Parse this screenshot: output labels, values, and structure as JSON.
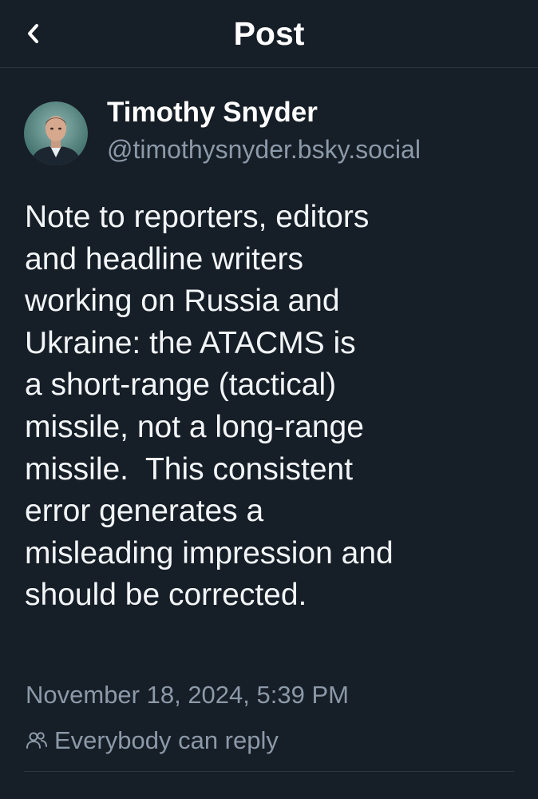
{
  "header": {
    "title": "Post",
    "back_icon": "chevron-left-icon"
  },
  "author": {
    "name": "Timothy Snyder",
    "handle": "@timothysnyder.bsky.social",
    "avatar_icon": "user-avatar-photo"
  },
  "post": {
    "lines": [
      "Note to reporters, editors",
      "and headline writers",
      "working on Russia and",
      "Ukraine: the ATACMS is",
      "a short-range (tactical)",
      "missile, not a long-range",
      "missile.  This consistent",
      "error generates a",
      "misleading impression and",
      "should be corrected."
    ],
    "timestamp": "November 18, 2024, 5:39 PM",
    "reply_setting": "Everybody can reply",
    "reply_icon": "people-icon"
  },
  "colors": {
    "background": "#161e27",
    "text_primary": "#ffffff",
    "text_secondary": "#8c99a8",
    "divider": "#2a3541"
  }
}
